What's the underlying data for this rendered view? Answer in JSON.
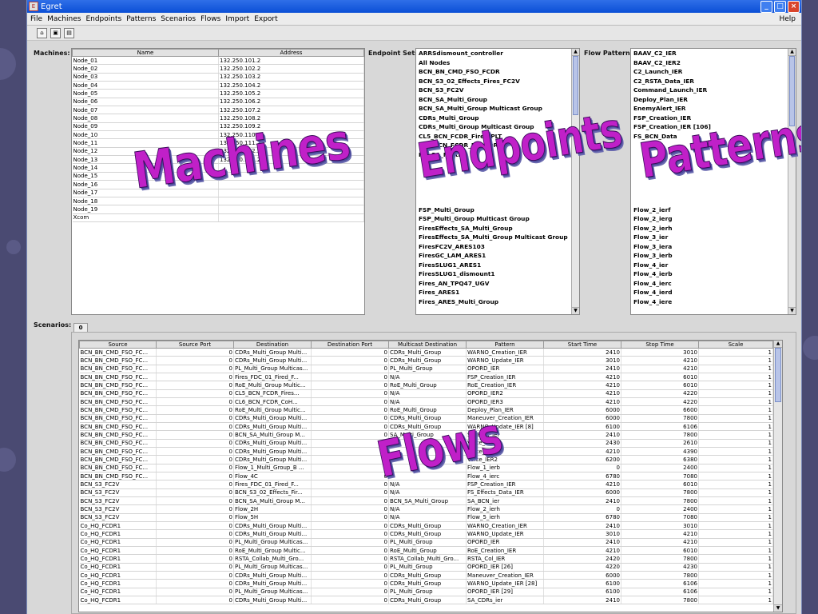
{
  "window": {
    "title": "Egret"
  },
  "menu": {
    "items": [
      "File",
      "Machines",
      "Endpoints",
      "Patterns",
      "Scenarios",
      "Flows",
      "Import",
      "Export"
    ],
    "help": "Help"
  },
  "toolbar": {
    "icons": [
      "open-icon",
      "save-icon",
      "save-all-icon"
    ]
  },
  "machines": {
    "label": "Machines:",
    "columns": [
      "Name",
      "Address"
    ],
    "rows": [
      [
        "Node_01",
        "132.250.101.2"
      ],
      [
        "Node_02",
        "132.250.102.2"
      ],
      [
        "Node_03",
        "132.250.103.2"
      ],
      [
        "Node_04",
        "132.250.104.2"
      ],
      [
        "Node_05",
        "132.250.105.2"
      ],
      [
        "Node_06",
        "132.250.106.2"
      ],
      [
        "Node_07",
        "132.250.107.2"
      ],
      [
        "Node_08",
        "132.250.108.2"
      ],
      [
        "Node_09",
        "132.250.109.2"
      ],
      [
        "Node_10",
        "132.250.110.2"
      ],
      [
        "Node_11",
        "132.250.111.2"
      ],
      [
        "Node_12",
        "132.250.112.2"
      ],
      [
        "Node_13",
        "132.250.113.2"
      ],
      [
        "Node_14",
        ""
      ],
      [
        "Node_15",
        ""
      ],
      [
        "Node_16",
        ""
      ],
      [
        "Node_17",
        ""
      ],
      [
        "Node_18",
        ""
      ],
      [
        "Node_19",
        ""
      ],
      [
        "Xcom",
        ""
      ]
    ]
  },
  "endpoints": {
    "label": "Endpoint Sets:",
    "items": [
      "ARRSdismount_controller",
      "All Nodes",
      "BCN_BN_CMD_FSO_FCDR",
      "BCN_S3_02_Effects_Fires_FC2V",
      "BCN_S3_FC2V",
      "BCN_SA_Multi_Group",
      "BCN_SA_Multi_Group Multicast Group",
      "CDRs_Multi_Group",
      "CDRs_Multi_Group Multicast Group",
      "CL5_BCN_FCDR_Fires_PLT",
      "CL6_BCN_FCDR_HQ_CDR",
      "HQ_SA_Multi",
      "",
      "",
      "",
      "",
      "",
      "FSP_Multi_Group",
      "FSP_Multi_Group Multicast Group",
      "FiresEffects_SA_Multi_Group",
      "FiresEffects_SA_Multi_Group Multicast Group",
      "FiresFC2V_ARES103",
      "FiresGC_LAM_ARES1",
      "FiresSLUG1_ARES1",
      "FiresSLUG1_dismount1",
      "Fires_AN_TPQ47_UGV",
      "Fires_ARES1",
      "Fires_ARES_Multi_Group"
    ]
  },
  "patterns": {
    "label": "Flow Patterns:",
    "items": [
      "BAAV_C2_IER",
      "BAAV_C2_IER2",
      "C2_Launch_IER",
      "C2_RSTA_Data_IER",
      "Command_Launch_IER",
      "Deploy_Plan_IER",
      "EnemyAlert_IER",
      "FSP_Creation_IER",
      "FSP_Creation_IER [106]",
      "FS_BCN_Data",
      "",
      "",
      "",
      "",
      "",
      "",
      "",
      "Flow_2_ierf",
      "Flow_2_ierg",
      "Flow_2_ierh",
      "Flow_3_ier",
      "Flow_3_iera",
      "Flow_3_ierb",
      "Flow_4_ier",
      "Flow_4_ierb",
      "Flow_4_ierc",
      "Flow_4_ierd",
      "Flow_4_iere"
    ]
  },
  "scenarios": {
    "label": "Scenarios:",
    "tab": "0",
    "columns": [
      "Source",
      "Source Port",
      "Destination",
      "Destination Port",
      "Multicast Destination",
      "Pattern",
      "Start Time",
      "Stop Time",
      "Scale"
    ],
    "rows": [
      [
        "BCN_BN_CMD_FSO_FC...",
        "0",
        "CDRs_Multi_Group Multi...",
        "0",
        "CDRs_Multi_Group",
        "WARNO_Creation_IER",
        "2410",
        "3010",
        "1"
      ],
      [
        "BCN_BN_CMD_FSO_FC...",
        "0",
        "CDRs_Multi_Group Multi...",
        "0",
        "CDRs_Multi_Group",
        "WARNO_Update_IER",
        "3010",
        "4210",
        "1"
      ],
      [
        "BCN_BN_CMD_FSO_FC...",
        "0",
        "PL_Multi_Group Multicas...",
        "0",
        "PL_Multi_Group",
        "OPORD_IER",
        "2410",
        "4210",
        "1"
      ],
      [
        "BCN_BN_CMD_FSO_FC...",
        "0",
        "Fires_FDC_01_Fired_F...",
        "0",
        "N/A",
        "FSP_Creation_IER",
        "4210",
        "6010",
        "1"
      ],
      [
        "BCN_BN_CMD_FSO_FC...",
        "0",
        "RoE_Multi_Group Multic...",
        "0",
        "RoE_Multi_Group",
        "RoE_Creation_IER",
        "4210",
        "6010",
        "1"
      ],
      [
        "BCN_BN_CMD_FSO_FC...",
        "0",
        "CL5_BCN_FCDR_Fires...",
        "0",
        "N/A",
        "OPORD_IER2",
        "4210",
        "4220",
        "1"
      ],
      [
        "BCN_BN_CMD_FSO_FC...",
        "0",
        "CL6_BCN_FCDR_CoH...",
        "0",
        "N/A",
        "OPORD_IER3",
        "4210",
        "4220",
        "1"
      ],
      [
        "BCN_BN_CMD_FSO_FC...",
        "0",
        "RoE_Multi_Group Multic...",
        "0",
        "RoE_Multi_Group",
        "Deploy_Plan_IER",
        "6000",
        "6600",
        "1"
      ],
      [
        "BCN_BN_CMD_FSO_FC...",
        "0",
        "CDRs_Multi_Group Multi...",
        "0",
        "CDRs_Multi_Group",
        "Maneuver_Creation_IER",
        "6000",
        "7800",
        "1"
      ],
      [
        "BCN_BN_CMD_FSO_FC...",
        "0",
        "CDRs_Multi_Group Multi...",
        "0",
        "CDRs_Multi_Group",
        "WARNO_Update_IER [8]",
        "6100",
        "6106",
        "1"
      ],
      [
        "BCN_BN_CMD_FSO_FC...",
        "0",
        "BCN_SA_Multi_Group M...",
        "0",
        "SA_Multi_Group",
        "SA_BCN_ier",
        "2410",
        "7800",
        "1"
      ],
      [
        "BCN_BN_CMD_FSO_FC...",
        "0",
        "CDRs_Multi_Group Multi...",
        "0",
        "",
        "Voice_IER2",
        "2430",
        "2610",
        "1"
      ],
      [
        "BCN_BN_CMD_FSO_FC...",
        "0",
        "CDRs_Multi_Group Multi...",
        "0",
        "",
        "Voice_IER2",
        "4210",
        "4390",
        "1"
      ],
      [
        "BCN_BN_CMD_FSO_FC...",
        "0",
        "CDRs_Multi_Group Multi...",
        "0",
        "",
        "Voice_IER2",
        "6200",
        "6380",
        "1"
      ],
      [
        "BCN_BN_CMD_FSO_FC...",
        "0",
        "Flow_1_Multi_Group_B ...",
        "0",
        "",
        "Flow_1_ierb",
        "0",
        "2400",
        "1"
      ],
      [
        "BCN_BN_CMD_FSO_FC...",
        "0",
        "Flow_4C",
        "0",
        "",
        "Flow_4_ierc",
        "6780",
        "7080",
        "1"
      ],
      [
        "BCN_S3_FC2V",
        "0",
        "Fires_FDC_01_Fired_F...",
        "0",
        "N/A",
        "FSP_Creation_IER",
        "4210",
        "6010",
        "1"
      ],
      [
        "BCN_S3_FC2V",
        "0",
        "BCN_S3_02_Effects_Fir...",
        "0",
        "N/A",
        "FS_Effects_Data_IER",
        "6000",
        "7800",
        "1"
      ],
      [
        "BCN_S3_FC2V",
        "0",
        "BCN_SA_Multi_Group M...",
        "0",
        "BCN_SA_Multi_Group",
        "SA_BCN_ier",
        "2410",
        "7800",
        "1"
      ],
      [
        "BCN_S3_FC2V",
        "0",
        "Flow_2H",
        "0",
        "N/A",
        "Flow_2_ierh",
        "0",
        "2400",
        "1"
      ],
      [
        "BCN_S3_FC2V",
        "0",
        "Flow_5H",
        "0",
        "N/A",
        "Flow_5_ierh",
        "6780",
        "7080",
        "1"
      ],
      [
        "Co_HQ_FCDR1",
        "0",
        "CDRs_Multi_Group Multi...",
        "0",
        "CDRs_Multi_Group",
        "WARNO_Creation_IER",
        "2410",
        "3010",
        "1"
      ],
      [
        "Co_HQ_FCDR1",
        "0",
        "CDRs_Multi_Group Multi...",
        "0",
        "CDRs_Multi_Group",
        "WARNO_Update_IER",
        "3010",
        "4210",
        "1"
      ],
      [
        "Co_HQ_FCDR1",
        "0",
        "PL_Multi_Group Multicas...",
        "0",
        "PL_Multi_Group",
        "OPORD_IER",
        "2410",
        "4210",
        "1"
      ],
      [
        "Co_HQ_FCDR1",
        "0",
        "RoE_Multi_Group Multic...",
        "0",
        "RoE_Multi_Group",
        "RoE_Creation_IER",
        "4210",
        "6010",
        "1"
      ],
      [
        "Co_HQ_FCDR1",
        "0",
        "RSTA_Collab_Multi_Gro...",
        "0",
        "RSTA_Collab_Multi_Gro...",
        "RSTA_Col_IER",
        "2420",
        "7800",
        "1"
      ],
      [
        "Co_HQ_FCDR1",
        "0",
        "PL_Multi_Group Multicas...",
        "0",
        "PL_Multi_Group",
        "OPORD_IER [26]",
        "4220",
        "4230",
        "1"
      ],
      [
        "Co_HQ_FCDR1",
        "0",
        "CDRs_Multi_Group Multi...",
        "0",
        "CDRs_Multi_Group",
        "Maneuver_Creation_IER",
        "6000",
        "7800",
        "1"
      ],
      [
        "Co_HQ_FCDR1",
        "0",
        "CDRs_Multi_Group Multi...",
        "0",
        "CDRs_Multi_Group",
        "WARNO_Update_IER [28]",
        "6100",
        "6106",
        "1"
      ],
      [
        "Co_HQ_FCDR1",
        "0",
        "PL_Multi_Group Multicas...",
        "0",
        "PL_Multi_Group",
        "OPORD_IER [29]",
        "6100",
        "6106",
        "1"
      ],
      [
        "Co_HQ_FCDR1",
        "0",
        "CDRs_Multi_Group Multi...",
        "0",
        "CDRs_Multi_Group",
        "SA_CDRs_ier",
        "2410",
        "7800",
        "1"
      ]
    ]
  },
  "overlays": {
    "machines": "Machines",
    "endpoints": "Endpoints",
    "patterns": "Patterns",
    "flows": "Flows"
  }
}
